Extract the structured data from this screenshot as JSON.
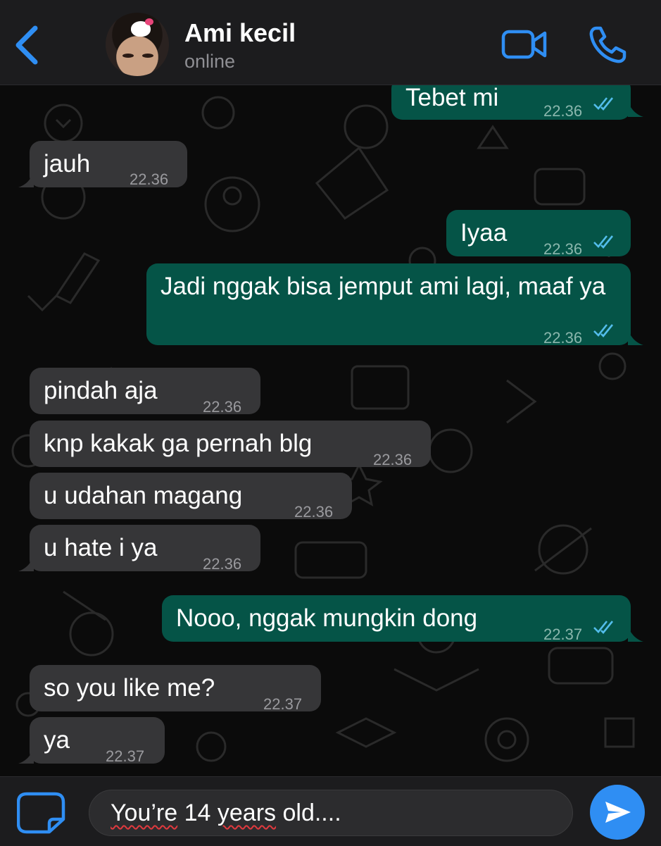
{
  "header": {
    "contact_name": "Ami kecil",
    "status": "online",
    "icons": [
      "chevron-left-icon",
      "video-camera-icon",
      "phone-icon"
    ]
  },
  "messages": [
    {
      "dir": "out",
      "text": "Tebet mi",
      "time": "22.36",
      "read": true
    },
    {
      "dir": "in",
      "text": "jauh",
      "time": "22.36"
    },
    {
      "dir": "out",
      "text": "Iyaa",
      "time": "22.36",
      "read": true
    },
    {
      "dir": "out",
      "text": "Jadi nggak bisa jemput ami lagi, maaf ya",
      "time": "22.36",
      "read": true
    },
    {
      "dir": "in",
      "text": "pindah aja",
      "time": "22.36"
    },
    {
      "dir": "in",
      "text": "knp kakak ga pernah blg",
      "time": "22.36"
    },
    {
      "dir": "in",
      "text": "u udahan magang",
      "time": "22.36"
    },
    {
      "dir": "in",
      "text": "u hate i ya",
      "time": "22.36"
    },
    {
      "dir": "out",
      "text": "Nooo, nggak mungkin dong",
      "time": "22.37",
      "read": true
    },
    {
      "dir": "in",
      "text": "so you like me?",
      "time": "22.37"
    },
    {
      "dir": "in",
      "text": "ya",
      "time": "22.37"
    }
  ],
  "composer": {
    "value_parts": [
      "You’re",
      " 14 ",
      "years",
      " old...."
    ],
    "misspelled_parts": [
      0,
      2
    ]
  },
  "colors": {
    "incoming_bubble": "#363638",
    "outgoing_bubble": "#055447",
    "accent": "#2f8ef3",
    "read_ticks": "#53bdeb"
  }
}
